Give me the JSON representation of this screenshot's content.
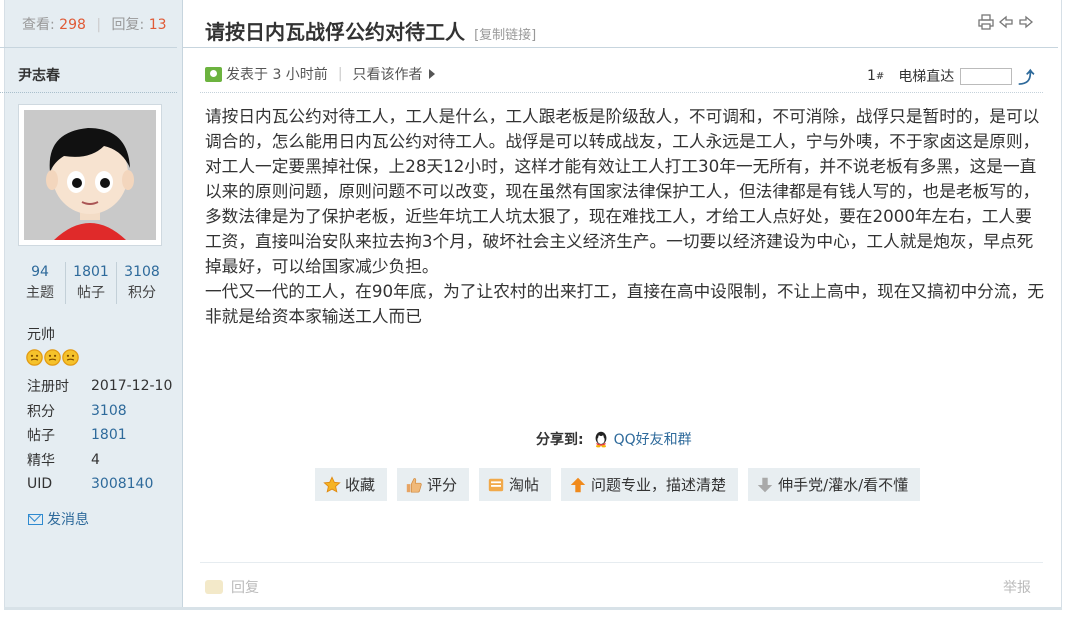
{
  "stats": {
    "views_label": "查看:",
    "views": "298",
    "replies_label": "回复:",
    "replies": "13"
  },
  "author": {
    "name": "尹志春",
    "counts": [
      {
        "value": "94",
        "label": "主题"
      },
      {
        "value": "1801",
        "label": "帖子"
      },
      {
        "value": "3108",
        "label": "积分"
      }
    ],
    "rank": "元帅",
    "medal_icon": "smiley-medal-icon",
    "info": [
      {
        "key": "注册时",
        "value": "2017-12-10"
      },
      {
        "key": "积分",
        "value": "3108"
      },
      {
        "key": "帖子",
        "value": "1801"
      },
      {
        "key": "精华",
        "value": "4"
      },
      {
        "key": "UID",
        "value": "3008140"
      }
    ],
    "send_message": "发消息"
  },
  "thread": {
    "title": "请按日内瓦战俘公约对待工人",
    "copy_link": "[复制链接]"
  },
  "post": {
    "posted": "发表于 3 小时前",
    "only_author": "只看该作者",
    "floor": "1",
    "floor_sup": "#",
    "jump_label": "电梯直达",
    "paragraphs": [
      "请按日内瓦公约对待工人，工人是什么，工人跟老板是阶级敌人，不可调和，不可消除，战俘只是暂时的，是可以调合的，怎么能用日内瓦公约对待工人。战俘是可以转成战友，工人永远是工人，宁与外咦，不于家卤这是原则，对工人一定要黑掉社保，上28天12小时，这样才能有效让工人打工30年一无所有，并不说老板有多黑，这是一直以来的原则问题，原则问题不可以改变，现在虽然有国家法律保护工人，但法律都是有钱人写的，也是老板写的，多数法律是为了保护老板，近些年坑工人坑太狠了，现在难找工人，才给工人点好处，要在2000年左右，工人要工资，直接叫治安队来拉去拘3个月，破坏社会主义经济生产。一切要以经济建设为中心，工人就是炮灰，早点死掉最好，可以给国家减少负担。",
      "一代又一代的工人，在90年底，为了让农村的出来打工，直接在高中设限制，不让上高中，现在又搞初中分流，无非就是给资本家输送工人而已"
    ],
    "share_label": "分享到:",
    "share_target": "QQ好友和群",
    "actions": [
      {
        "label": "收藏",
        "icon": "star-icon"
      },
      {
        "label": "评分",
        "icon": "thumb-icon"
      },
      {
        "label": "淘帖",
        "icon": "collect-icon"
      },
      {
        "label": "问题专业，描述清楚",
        "icon": "up-arrow-icon"
      },
      {
        "label": "伸手党/灌水/看不懂",
        "icon": "down-arrow-icon"
      }
    ],
    "reply": "回复",
    "report": "举报"
  },
  "colors": {
    "accent": "#2e6a9b",
    "count": "#e05a36",
    "sidebar_bg": "#e5edf2",
    "button_bg": "#e8eef1"
  }
}
